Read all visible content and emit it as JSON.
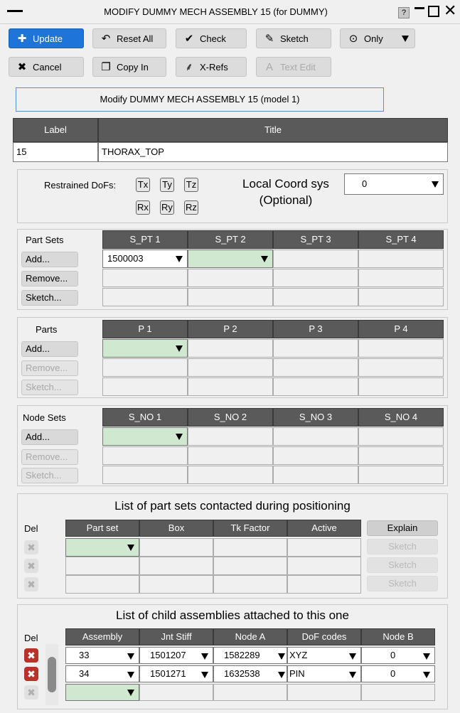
{
  "window": {
    "title": "MODIFY DUMMY MECH ASSEMBLY 15 (for DUMMY)",
    "help": "?"
  },
  "toolbar": {
    "update": "Update",
    "reset_all": "Reset All",
    "check": "Check",
    "sketch": "Sketch",
    "only": "Only",
    "cancel": "Cancel",
    "copy_in": "Copy In",
    "x_refs": "X-Refs",
    "text_edit": "Text Edit"
  },
  "heading": "Modify DUMMY MECH ASSEMBLY 15 (model 1)",
  "label_title": {
    "label_header": "Label",
    "title_header": "Title",
    "label": "15",
    "title": "THORAX_TOP"
  },
  "dofs": {
    "label": "Restrained DoFs:",
    "buttons": [
      "Tx",
      "Ty",
      "Tz",
      "Rx",
      "Ry",
      "Rz"
    ],
    "coord_label_1": "Local Coord sys",
    "coord_label_2": "(Optional)",
    "coord_value": "0"
  },
  "part_sets": {
    "label": "Part Sets",
    "headers": [
      "S_PT 1",
      "S_PT 2",
      "S_PT 3",
      "S_PT 4"
    ],
    "add": "Add...",
    "remove": "Remove...",
    "sketch": "Sketch...",
    "value": "1500003"
  },
  "parts": {
    "label": "Parts",
    "headers": [
      "P 1",
      "P 2",
      "P 3",
      "P 4"
    ],
    "add": "Add...",
    "remove": "Remove...",
    "sketch": "Sketch..."
  },
  "node_sets": {
    "label": "Node Sets",
    "headers": [
      "S_NO 1",
      "S_NO 2",
      "S_NO 3",
      "S_NO 4"
    ],
    "add": "Add...",
    "remove": "Remove...",
    "sketch": "Sketch..."
  },
  "contact": {
    "title": "List of part sets contacted during positioning",
    "del": "Del",
    "headers": [
      "Part set",
      "Box",
      "Tk Factor",
      "Active"
    ],
    "explain": "Explain",
    "sketch": "Sketch"
  },
  "child": {
    "title": "List of child assemblies attached to this one",
    "del": "Del",
    "headers": [
      "Assembly",
      "Jnt Stiff",
      "Node A",
      "DoF codes",
      "Node B"
    ],
    "rows": [
      {
        "assembly": "33",
        "jnt_stiff": "1501207",
        "node_a": "1582289",
        "dof": "XYZ",
        "node_b": "0"
      },
      {
        "assembly": "34",
        "jnt_stiff": "1501271",
        "node_a": "1632538",
        "dof": "PIN",
        "node_b": "0"
      }
    ]
  },
  "colors": {
    "accent": "#1e74d9",
    "header": "#5a5a5a",
    "selected": "#cfe8cf",
    "delete": "#b8322a"
  }
}
